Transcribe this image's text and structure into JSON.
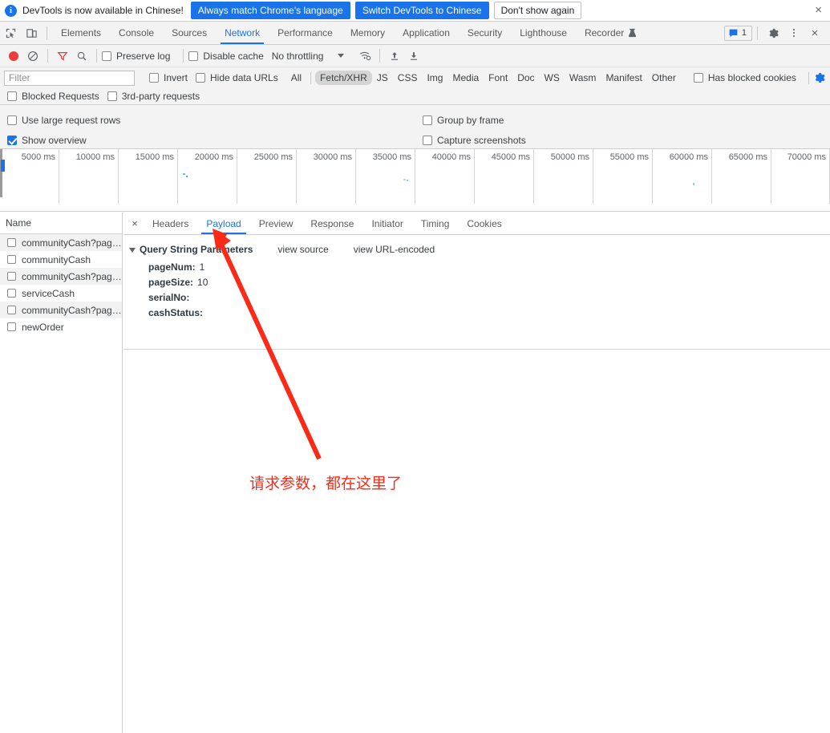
{
  "notification": {
    "icon": "info-icon",
    "message": "DevTools is now available in Chinese!",
    "primary_button": "Always match Chrome's language",
    "secondary_button": "Switch DevTools to Chinese",
    "dismiss_button": "Don't show again",
    "close_icon": "×",
    "primary_color": "#1a73e8"
  },
  "panel_tabs": {
    "inspect_icon": "inspect-element-icon",
    "device_icon": "device-toolbar-icon",
    "items": [
      {
        "label": "Elements",
        "active": false
      },
      {
        "label": "Console",
        "active": false
      },
      {
        "label": "Sources",
        "active": false
      },
      {
        "label": "Network",
        "active": true
      },
      {
        "label": "Performance",
        "active": false
      },
      {
        "label": "Memory",
        "active": false
      },
      {
        "label": "Application",
        "active": false
      },
      {
        "label": "Security",
        "active": false
      },
      {
        "label": "Lighthouse",
        "active": false
      },
      {
        "label": "Recorder",
        "active": false,
        "icon": "experiment-flask-icon"
      }
    ],
    "issues_count": "1",
    "issues_icon": "issues-message-icon",
    "settings_icon": "gear-icon",
    "more_icon": "kebab-menu-icon",
    "close_icon": "×",
    "active_color": "#1a73e8"
  },
  "network_toolbar": {
    "record_icon": "record-button-icon",
    "clear_icon": "clear-requests-icon",
    "filter_icon": "filter-funnel-icon",
    "search_icon": "search-icon",
    "preserve_log": {
      "label": "Preserve log",
      "checked": false
    },
    "disable_cache": {
      "label": "Disable cache",
      "checked": false
    },
    "throttling": "No throttling",
    "throttle_caret_icon": "chevron-down-icon",
    "wifi_icon": "network-conditions-icon",
    "import_icon": "import-har-icon",
    "export_icon": "export-har-icon"
  },
  "filter_row": {
    "placeholder": "Filter",
    "value": "",
    "invert": {
      "label": "Invert",
      "checked": false
    },
    "hide_data_urls": {
      "label": "Hide data URLs",
      "checked": false
    },
    "types": [
      {
        "label": "All",
        "selected": false
      },
      {
        "label": "Fetch/XHR",
        "selected": true
      },
      {
        "label": "JS",
        "selected": false
      },
      {
        "label": "CSS",
        "selected": false
      },
      {
        "label": "Img",
        "selected": false
      },
      {
        "label": "Media",
        "selected": false
      },
      {
        "label": "Font",
        "selected": false
      },
      {
        "label": "Doc",
        "selected": false
      },
      {
        "label": "WS",
        "selected": false
      },
      {
        "label": "Wasm",
        "selected": false
      },
      {
        "label": "Manifest",
        "selected": false
      },
      {
        "label": "Other",
        "selected": false
      }
    ],
    "has_blocked_cookies": {
      "label": "Has blocked cookies",
      "checked": false
    },
    "settings_icon": "network-settings-gear-icon",
    "settings_icon_color": "#1a73e8"
  },
  "blocked_row": {
    "blocked_requests": {
      "label": "Blocked Requests",
      "checked": false
    },
    "third_party": {
      "label": "3rd-party requests",
      "checked": false
    }
  },
  "settings_pane": {
    "left": [
      {
        "label": "Use large request rows",
        "checked": false
      },
      {
        "label": "Show overview",
        "checked": true
      }
    ],
    "right": [
      {
        "label": "Group by frame",
        "checked": false
      },
      {
        "label": "Capture screenshots",
        "checked": false
      }
    ]
  },
  "overview": {
    "ticks": [
      "5000 ms",
      "10000 ms",
      "15000 ms",
      "20000 ms",
      "25000 ms",
      "30000 ms",
      "35000 ms",
      "40000 ms",
      "45000 ms",
      "50000 ms",
      "55000 ms",
      "60000 ms",
      "65000 ms",
      "70000 ms"
    ]
  },
  "request_list": {
    "column_header": "Name",
    "rows": [
      {
        "name": "communityCash?pag…",
        "selected": true
      },
      {
        "name": "communityCash",
        "selected": false
      },
      {
        "name": "communityCash?pag…",
        "selected": false
      },
      {
        "name": "serviceCash",
        "selected": false
      },
      {
        "name": "communityCash?pag…",
        "selected": false
      },
      {
        "name": "newOrder",
        "selected": false
      }
    ]
  },
  "detail_pane": {
    "close_icon": "×",
    "tabs": [
      {
        "label": "Headers",
        "active": false
      },
      {
        "label": "Payload",
        "active": true
      },
      {
        "label": "Preview",
        "active": false
      },
      {
        "label": "Response",
        "active": false
      },
      {
        "label": "Initiator",
        "active": false
      },
      {
        "label": "Timing",
        "active": false
      },
      {
        "label": "Cookies",
        "active": false
      }
    ],
    "payload": {
      "section_title": "Query String Parameters",
      "disclosure_icon": "disclosure-triangle-open-icon",
      "view_source": "view source",
      "view_url_encoded": "view URL-encoded",
      "params": [
        {
          "key": "pageNum:",
          "value": "1"
        },
        {
          "key": "pageSize:",
          "value": "10"
        },
        {
          "key": "serialNo:",
          "value": ""
        },
        {
          "key": "cashStatus:",
          "value": ""
        }
      ]
    }
  },
  "annotation": {
    "text": "请求参数，都在这里了",
    "color": "#fb2a17",
    "arrow_icon": "annotation-arrow-icon"
  }
}
